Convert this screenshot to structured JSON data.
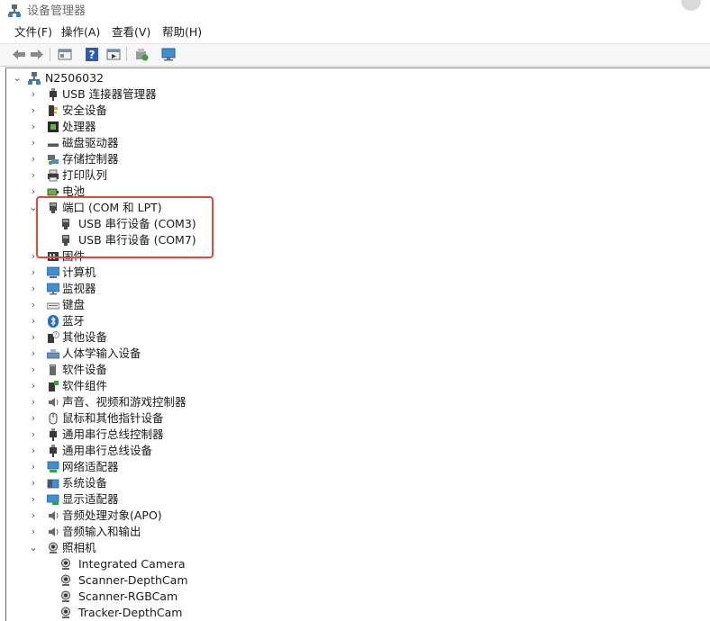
{
  "window": {
    "title": "设备管理器"
  },
  "menu": [
    {
      "label": "文件(F)"
    },
    {
      "label": "操作(A)"
    },
    {
      "label": "查看(V)"
    },
    {
      "label": "帮助(H)"
    }
  ],
  "toolbar": {
    "icons": [
      "back-arrow-icon",
      "forward-arrow-icon",
      "properties-icon",
      "help-icon",
      "run-icon",
      "scan-hardware-icon",
      "monitor-icon"
    ]
  },
  "tree": {
    "root": {
      "label": "N2506032",
      "expanded": true
    },
    "categories": [
      {
        "label": "USB 连接器管理器",
        "icon": "usb-plug-icon"
      },
      {
        "label": "安全设备",
        "icon": "security-key-icon"
      },
      {
        "label": "处理器",
        "icon": "processor-icon"
      },
      {
        "label": "磁盘驱动器",
        "icon": "disk-drive-icon"
      },
      {
        "label": "存储控制器",
        "icon": "storage-controller-icon"
      },
      {
        "label": "打印队列",
        "icon": "printer-icon"
      },
      {
        "label": "电池",
        "icon": "battery-icon"
      },
      {
        "label": "端口 (COM 和 LPT)",
        "icon": "port-icon",
        "expanded": true,
        "children": [
          {
            "label": "USB 串行设备 (COM3)",
            "icon": "port-icon"
          },
          {
            "label": "USB 串行设备 (COM7)",
            "icon": "port-icon"
          }
        ]
      },
      {
        "label": "固件",
        "icon": "firmware-icon"
      },
      {
        "label": "计算机",
        "icon": "computer-icon"
      },
      {
        "label": "监视器",
        "icon": "monitor-icon"
      },
      {
        "label": "键盘",
        "icon": "keyboard-icon"
      },
      {
        "label": "蓝牙",
        "icon": "bluetooth-icon"
      },
      {
        "label": "其他设备",
        "icon": "unknown-device-icon"
      },
      {
        "label": "人体学输入设备",
        "icon": "hid-icon"
      },
      {
        "label": "软件设备",
        "icon": "software-device-icon"
      },
      {
        "label": "软件组件",
        "icon": "software-component-icon"
      },
      {
        "label": "声音、视频和游戏控制器",
        "icon": "speaker-icon"
      },
      {
        "label": "鼠标和其他指针设备",
        "icon": "mouse-icon"
      },
      {
        "label": "通用串行总线控制器",
        "icon": "usb-plug-icon"
      },
      {
        "label": "通用串行总线设备",
        "icon": "usb-plug-icon"
      },
      {
        "label": "网络适配器",
        "icon": "network-adapter-icon"
      },
      {
        "label": "系统设备",
        "icon": "system-device-icon"
      },
      {
        "label": "显示适配器",
        "icon": "display-adapter-icon"
      },
      {
        "label": "音频处理对象(APO)",
        "icon": "speaker-icon"
      },
      {
        "label": "音频输入和输出",
        "icon": "speaker-icon"
      },
      {
        "label": "照相机",
        "icon": "camera-icon",
        "expanded": true,
        "children": [
          {
            "label": "Integrated Camera",
            "icon": "camera-icon"
          },
          {
            "label": "Scanner-DepthCam",
            "icon": "camera-icon"
          },
          {
            "label": "Scanner-RGBCam",
            "icon": "camera-icon"
          },
          {
            "label": "Tracker-DepthCam",
            "icon": "camera-icon"
          }
        ]
      }
    ]
  },
  "chevrons": {
    "collapsed": "›",
    "expanded": "⌄"
  },
  "colors": {
    "highlight": "#e04a3a",
    "text": "#1a1a1a",
    "chevron": "#555555"
  }
}
